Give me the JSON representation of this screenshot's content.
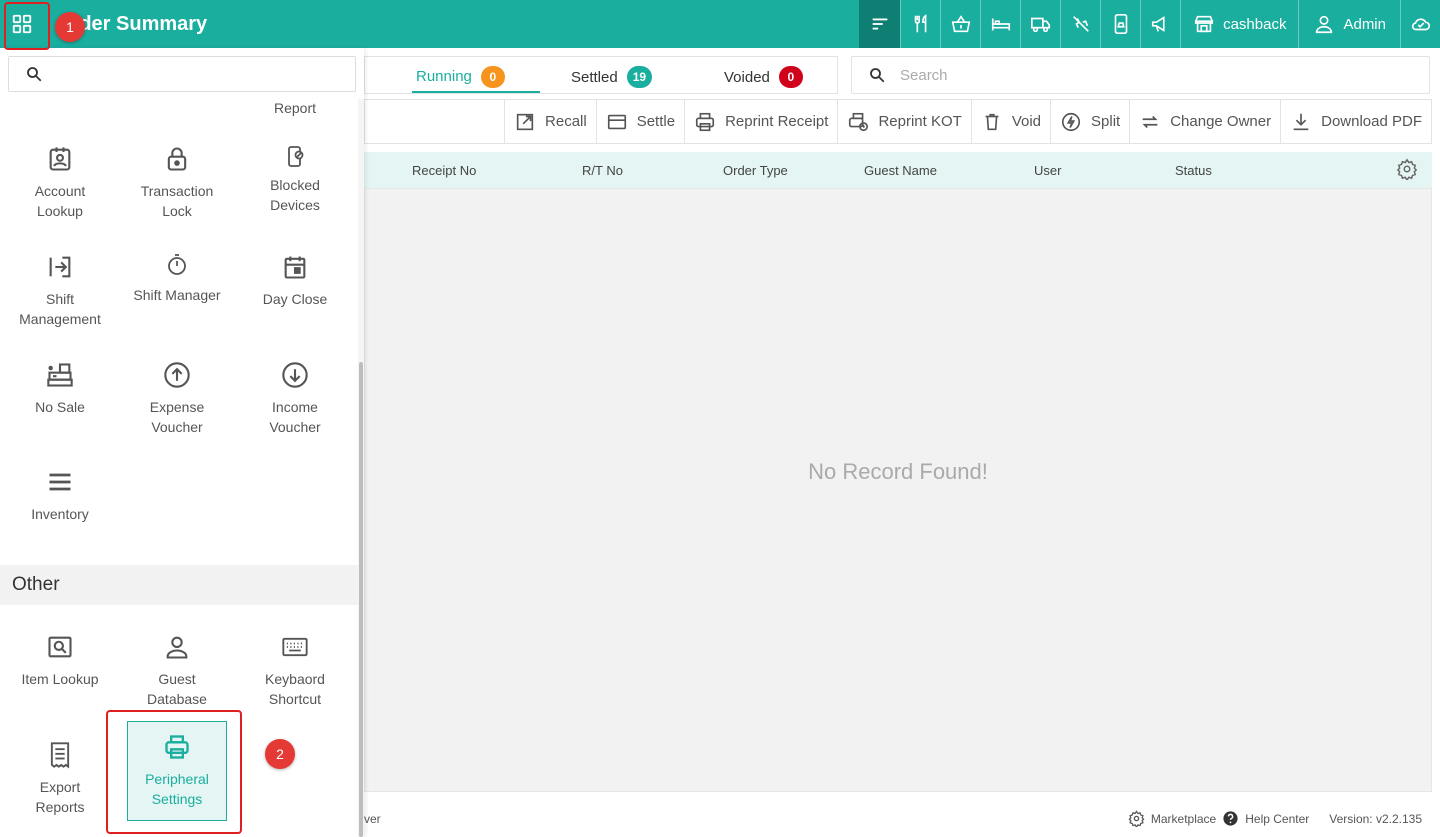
{
  "header": {
    "title": "Order Summary",
    "icons": [
      {
        "name": "sort-icon"
      },
      {
        "name": "fork-knife-icon"
      },
      {
        "name": "basket-icon"
      },
      {
        "name": "bed-icon"
      },
      {
        "name": "delivery-truck-icon"
      },
      {
        "name": "no-delivery-icon"
      },
      {
        "name": "mobile-order-icon"
      },
      {
        "name": "megaphone-icon"
      }
    ],
    "cashback_label": "cashback",
    "user_label": "Admin"
  },
  "tabs": [
    {
      "label": "Running",
      "count": "0",
      "color": "#f7941d"
    },
    {
      "label": "Settled",
      "count": "19",
      "color": "#1aae9f"
    },
    {
      "label": "Voided",
      "count": "0",
      "color": "#d0021b"
    }
  ],
  "search": {
    "placeholder": "Search"
  },
  "toolbar": {
    "recall": "Recall",
    "settle": "Settle",
    "reprint_receipt": "Reprint Receipt",
    "reprint_kot": "Reprint KOT",
    "void": "Void",
    "split": "Split",
    "change_owner": "Change Owner",
    "download_pdf": "Download PDF"
  },
  "table": {
    "columns": [
      "Receipt No",
      "R/T No",
      "Order Type",
      "Guest Name",
      "User",
      "Status"
    ],
    "empty_message": "No Record Found!"
  },
  "drawer": {
    "report_label": "Report",
    "items": [
      {
        "label": "Account Lookup",
        "icon": "account-lookup-icon"
      },
      {
        "label": "Transaction Lock",
        "icon": "lock-icon"
      },
      {
        "label": "Blocked Devices",
        "icon": "blocked-device-icon"
      },
      {
        "label": "Shift Management",
        "icon": "shift-login-icon"
      },
      {
        "label": "Shift Manager",
        "icon": "stopwatch-icon"
      },
      {
        "label": "Day Close",
        "icon": "calendar-icon"
      },
      {
        "label": "No Sale",
        "icon": "cash-register-icon"
      },
      {
        "label": "Expense Voucher",
        "icon": "arrow-up-circle-icon"
      },
      {
        "label": "Income Voucher",
        "icon": "arrow-down-circle-icon"
      },
      {
        "label": "Inventory",
        "icon": "list-icon"
      }
    ],
    "other_title": "Other",
    "other_items": [
      {
        "label": "Item Lookup",
        "icon": "item-lookup-icon"
      },
      {
        "label": "Guest Database",
        "icon": "person-icon"
      },
      {
        "label": "Keybaord Shortcut",
        "icon": "keyboard-icon"
      },
      {
        "label": "Export Reports",
        "icon": "receipt-icon"
      },
      {
        "label": "Peripheral Settings",
        "icon": "printer-icon"
      }
    ]
  },
  "footer": {
    "left_fragment": "ver",
    "marketplace": "Marketplace",
    "help": "Help Center",
    "version": "Version: v2.2.135"
  },
  "annotations": [
    "1",
    "2"
  ],
  "colors": {
    "brand": "#1aae9f",
    "brand_dark": "#0f7f74",
    "annotation": "#e53935"
  }
}
